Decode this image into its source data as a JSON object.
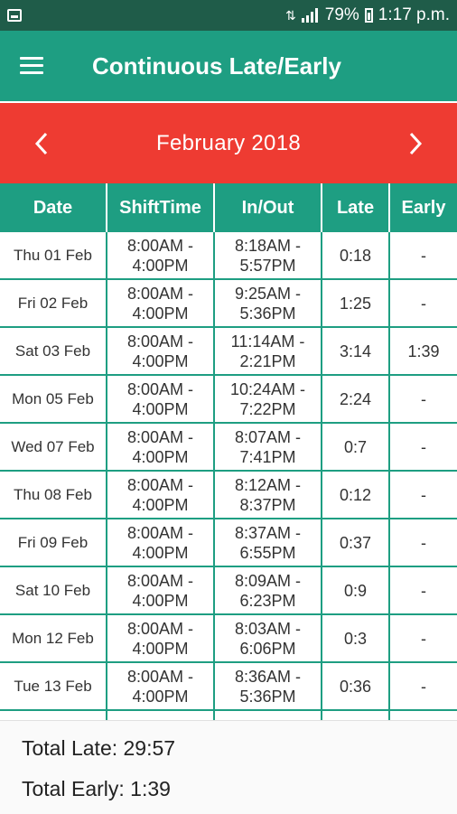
{
  "status_bar": {
    "battery": "79%",
    "time": "1:17 p.m.",
    "icons": [
      "notification-icon",
      "data-arrows-icon",
      "signal-icon",
      "battery-icon"
    ]
  },
  "app_bar": {
    "title": "Continuous Late/Early",
    "menu_icon": "menu-icon"
  },
  "month_nav": {
    "label": "February  2018",
    "prev_icon": "chevron-left-icon",
    "next_icon": "chevron-right-icon"
  },
  "table": {
    "headers": [
      "Date",
      "ShiftTime",
      "In/Out",
      "Late",
      "Early"
    ],
    "rows": [
      {
        "date": "Thu 01 Feb",
        "shift": "8:00AM -\n4:00PM",
        "inout": "8:18AM -\n5:57PM",
        "late": "0:18",
        "early": "-"
      },
      {
        "date": "Fri 02 Feb",
        "shift": "8:00AM -\n4:00PM",
        "inout": "9:25AM -\n5:36PM",
        "late": "1:25",
        "early": "-"
      },
      {
        "date": "Sat 03 Feb",
        "shift": "8:00AM -\n4:00PM",
        "inout": "11:14AM -\n2:21PM",
        "late": "3:14",
        "early": "1:39"
      },
      {
        "date": "Mon 05 Feb",
        "shift": "8:00AM -\n4:00PM",
        "inout": "10:24AM -\n7:22PM",
        "late": "2:24",
        "early": "-"
      },
      {
        "date": "Wed 07 Feb",
        "shift": "8:00AM -\n4:00PM",
        "inout": "8:07AM -\n7:41PM",
        "late": "0:7",
        "early": "-"
      },
      {
        "date": "Thu 08 Feb",
        "shift": "8:00AM -\n4:00PM",
        "inout": "8:12AM -\n8:37PM",
        "late": "0:12",
        "early": "-"
      },
      {
        "date": "Fri 09 Feb",
        "shift": "8:00AM -\n4:00PM",
        "inout": "8:37AM -\n6:55PM",
        "late": "0:37",
        "early": "-"
      },
      {
        "date": "Sat 10 Feb",
        "shift": "8:00AM -\n4:00PM",
        "inout": "8:09AM -\n6:23PM",
        "late": "0:9",
        "early": "-"
      },
      {
        "date": "Mon 12 Feb",
        "shift": "8:00AM -\n4:00PM",
        "inout": "8:03AM -\n6:06PM",
        "late": "0:3",
        "early": "-"
      },
      {
        "date": "Tue 13 Feb",
        "shift": "8:00AM -\n4:00PM",
        "inout": "8:36AM -\n5:36PM",
        "late": "0:36",
        "early": "-"
      },
      {
        "date": "",
        "shift": "8:00AM -",
        "inout": "8:41AM -",
        "late": "",
        "early": ""
      }
    ]
  },
  "totals": {
    "late": "Total Late: 29:57",
    "early": "Total Early: 1:39"
  },
  "colors": {
    "status_bar": "#1f5c49",
    "primary": "#1e9e82",
    "month_bar": "#ee3b32"
  }
}
